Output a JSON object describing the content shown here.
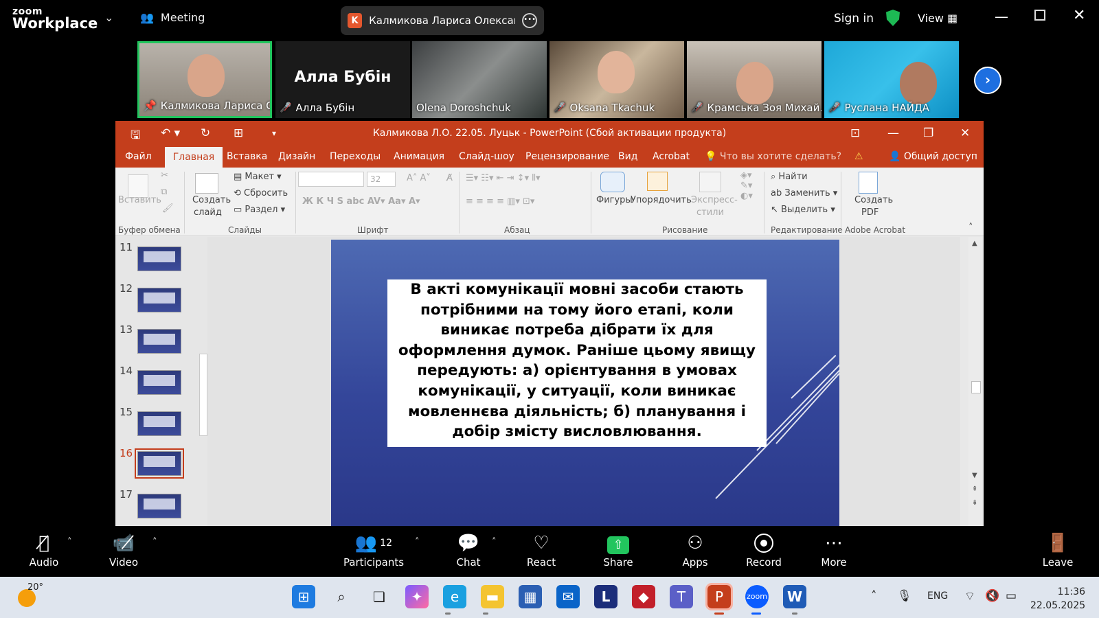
{
  "zoom": {
    "brand_top": "zoom",
    "brand_bottom": "Workplace",
    "meeting_label": "Meeting",
    "speaker_initial": "K",
    "speaker_name": "Калмикова Лариса Олександрівна",
    "sign_in": "Sign in",
    "view": "View"
  },
  "participants": [
    {
      "name": "Калмикова Лариса О...",
      "pinned": true
    },
    {
      "name": "Алла Бубін",
      "big_name": "Алла Бубін",
      "muted": true
    },
    {
      "name": "Olena Doroshchuk"
    },
    {
      "name": "Oksana Tkachuk",
      "muted": true
    },
    {
      "name": "Крамська Зоя Михай...",
      "muted": true
    },
    {
      "name": "Руслана НАЙДА",
      "muted": true
    }
  ],
  "ppt": {
    "title": "Калмикова Л.О. 22.05. Луцьк - PowerPoint (Сбой активации продукта)",
    "tabs": [
      "Файл",
      "Главная",
      "Вставка",
      "Дизайн",
      "Переходы",
      "Анимация",
      "Слайд-шоу",
      "Рецензирование",
      "Вид",
      "Acrobat"
    ],
    "tell_me": "Что вы хотите сделать?",
    "share": "Общий доступ",
    "ribbon": {
      "paste": "Вставить",
      "clipboard_group": "Буфер обмена",
      "new_slide_1": "Создать",
      "new_slide_2": "слайд",
      "layout": "Макет",
      "reset": "Сбросить",
      "section": "Раздел",
      "slides_group": "Слайды",
      "font_size": "32",
      "font_group": "Шрифт",
      "paragraph_group": "Абзац",
      "shapes": "Фигуры",
      "arrange": "Упорядочить",
      "styles_1": "Экспресс-",
      "styles_2": "стили",
      "drawing_group": "Рисование",
      "find": "Найти",
      "replace": "Заменить",
      "select": "Выделить",
      "editing_group": "Редактирование",
      "create_pdf_1": "Создать",
      "create_pdf_2": "PDF",
      "acrobat_group": "Adobe Acrobat"
    },
    "slide_numbers": [
      "11",
      "12",
      "13",
      "14",
      "15",
      "16",
      "17"
    ],
    "selected_slide": "16",
    "slide_text": "В акті комунікації мовні засоби стають потрібними на тому його етапі, коли виникає потреба дібрати їх для оформлення думок. Раніше цьому явищу передують: а) орієнтування в умовах комунікації, у ситуації, коли виникає мовленнєва діяльність; б) планування і добір змісту висловлювання."
  },
  "toolbar": {
    "audio": "Audio",
    "video": "Video",
    "participants": "Participants",
    "participants_count": "12",
    "chat": "Chat",
    "react": "React",
    "share": "Share",
    "apps": "Apps",
    "record": "Record",
    "more": "More",
    "leave": "Leave"
  },
  "taskbar": {
    "temperature": "20°",
    "lang": "ENG",
    "time": "11:36",
    "date": "22.05.2025"
  },
  "colors": {
    "ppt_accent": "#c43e1c",
    "zoom_share": "#22c55e",
    "active_speaker": "#22c55e"
  }
}
